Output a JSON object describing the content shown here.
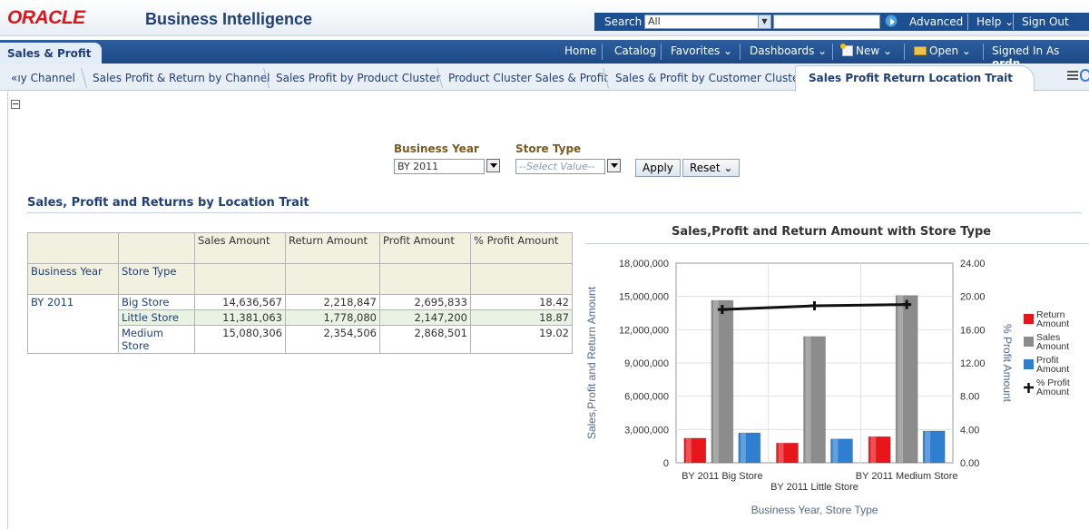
{
  "header": {
    "logo": "ORACLE",
    "product": "Business Intelligence",
    "search_label": "Search",
    "search_scope": "All",
    "advanced": "Advanced",
    "help": "Help ⌄",
    "signout": "Sign Out"
  },
  "nav": {
    "dashboard": "Sales & Profit",
    "home": "Home",
    "catalog": "Catalog",
    "favorites": "Favorites ⌄",
    "dashboards": "Dashboards ⌄",
    "new": "New ⌄",
    "open": "Open ⌄",
    "signed_in": "Signed In As",
    "user": "ordn"
  },
  "tabs": [
    "«ıy Channel",
    "Sales Profit & Return by Channel",
    "Sales Profit by Product Cluster",
    "Product Cluster Sales & Profit",
    "Sales & Profit by Customer Cluster"
  ],
  "active_tab": "Sales Profit Return Location Trait",
  "prompts": {
    "year_label": "Business Year",
    "year_value": "BY 2011",
    "store_label": "Store Type",
    "store_placeholder": "--Select Value--",
    "apply": "Apply",
    "reset": "Reset ⌄"
  },
  "section_title": "Sales, Profit and Returns by Location Trait",
  "table": {
    "col_headers": [
      "Sales Amount",
      "Return Amount",
      "Profit Amount",
      "% Profit Amount"
    ],
    "row_headers": [
      "Business Year",
      "Store Type"
    ],
    "year": "BY 2011",
    "rows": [
      {
        "store": "Big Store",
        "sales": "14,636,567",
        "return": "2,218,847",
        "profit": "2,695,833",
        "pct": "18.42"
      },
      {
        "store": "Little Store",
        "sales": "11,381,063",
        "return": "1,778,080",
        "profit": "2,147,200",
        "pct": "18.87"
      },
      {
        "store": "Medium Store",
        "sales": "15,080,306",
        "return": "2,354,506",
        "profit": "2,868,501",
        "pct": "19.02"
      }
    ]
  },
  "chart_data": {
    "type": "bar",
    "title": "Sales,Profit and Return Amount with Store Type",
    "categories": [
      "BY 2011 Big Store",
      "BY 2011 Little Store",
      "BY 2011 Medium Store"
    ],
    "xlabel": "Business Year, Store Type",
    "ylabel": "Sales,Profit and Return Amount",
    "y2label": "% Profit Amount",
    "ylim": [
      0,
      18000000
    ],
    "y2lim": [
      0,
      24
    ],
    "yticks": [
      "0",
      "3,000,000",
      "6,000,000",
      "9,000,000",
      "12,000,000",
      "15,000,000",
      "18,000,000"
    ],
    "y2ticks": [
      "0.00",
      "4.00",
      "8.00",
      "12.00",
      "16.00",
      "20.00",
      "24.00"
    ],
    "series": [
      {
        "name": "Return Amount",
        "type": "bar",
        "color": "#e8161b",
        "values": [
          2218847,
          1778080,
          2354506
        ]
      },
      {
        "name": "Sales Amount",
        "type": "bar",
        "color": "#8c8c8c",
        "values": [
          14636567,
          11381063,
          15080306
        ]
      },
      {
        "name": "Profit Amount",
        "type": "bar",
        "color": "#2f7fd0",
        "values": [
          2695833,
          2147200,
          2868501
        ]
      },
      {
        "name": "% Profit Amount",
        "type": "line",
        "axis": "y2",
        "color": "#111111",
        "values": [
          18.42,
          18.87,
          19.02
        ]
      }
    ],
    "legend": "right",
    "grid": true
  }
}
